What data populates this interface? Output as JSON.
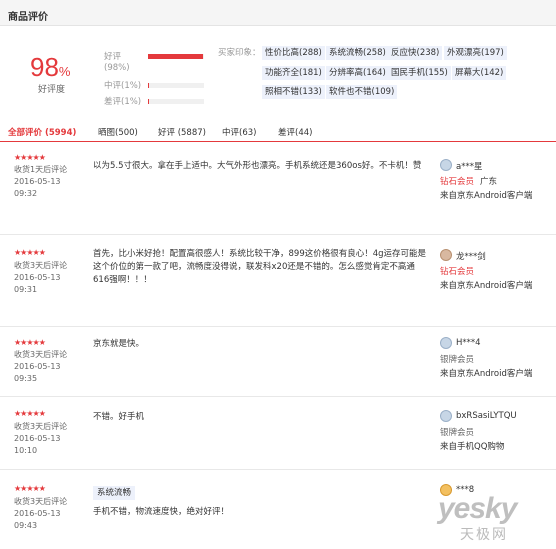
{
  "header": {
    "title": "商品评价"
  },
  "summary": {
    "rate_value": "98",
    "rate_suffix": "%",
    "rate_label": "好评度",
    "distribution": [
      {
        "label": "好评",
        "sub": "(98%)",
        "fraction": 0.98
      },
      {
        "label": "中评(1%)",
        "fraction": 0.01
      },
      {
        "label": "差评(1%)",
        "fraction": 0.01
      }
    ],
    "impression_label": "买家印象：",
    "tags": [
      "性价比高(288)",
      "系统流畅(258)",
      "反应快(238)",
      "外观漂亮(197)",
      "功能齐全(181)",
      "分辨率高(164)",
      "国民手机(155)",
      "屏幕大(142)",
      "照相不错(133)",
      "软件也不错(109)"
    ]
  },
  "tabs": [
    {
      "label": "全部评价 (5994)",
      "active": true
    },
    {
      "label": "晒图(500)"
    },
    {
      "label": "好评 (5887)"
    },
    {
      "label": "中评(63)"
    },
    {
      "label": "差评(44)"
    }
  ],
  "reviews": [
    {
      "stars": "★★★★★",
      "after": "收货1天后评论",
      "date": "2016-05-13",
      "time": "09:32",
      "content": "以为5.5寸很大。拿在手上适中。大气外形也漂亮。手机系统还是360os好。不卡机！赞",
      "user": "a***星",
      "level": "钻石会员",
      "location": "广东",
      "from": "来自京东Android客户端"
    },
    {
      "stars": "★★★★★",
      "after": "收货3天后评论",
      "date": "2016-05-13",
      "time": "09:31",
      "content": "首先，比小米好抢！配置高很感人！系统比较干净，899这价格很有良心！4g运存可能是这个价位的第一款了吧，流畅度没得说，联发科x20还是不错的。怎么感觉肯定不高通616强啊！！！",
      "user": "龙***剑",
      "level": "钻石会员",
      "location": "",
      "from": "来自京东Android客户端"
    },
    {
      "stars": "★★★★★",
      "after": "收货3天后评论",
      "date": "2016-05-13",
      "time": "09:35",
      "content": "京东就是快。",
      "user": "H***4",
      "level": "银牌会员",
      "location": "",
      "from": "来自京东Android客户端"
    },
    {
      "stars": "★★★★★",
      "after": "收货3天后评论",
      "date": "2016-05-13",
      "time": "10:10",
      "content": "不错。好手机",
      "user": "bxRSasiLYTQU",
      "level": "银牌会员",
      "location": "",
      "from": "来自手机QQ购物"
    },
    {
      "stars": "★★★★★",
      "after": "收货3天后评论",
      "date": "2016-05-13",
      "time": "09:43",
      "tag": "系统流畅",
      "content": "手机不错，物流速度快，绝对好评！",
      "user": "***8",
      "level": "",
      "location": "",
      "from": ""
    }
  ],
  "watermark": {
    "brand": "yesky",
    "cn": "天极网"
  },
  "colors": {
    "accent": "#e4393c",
    "tag_bg": "#edf1fb"
  }
}
